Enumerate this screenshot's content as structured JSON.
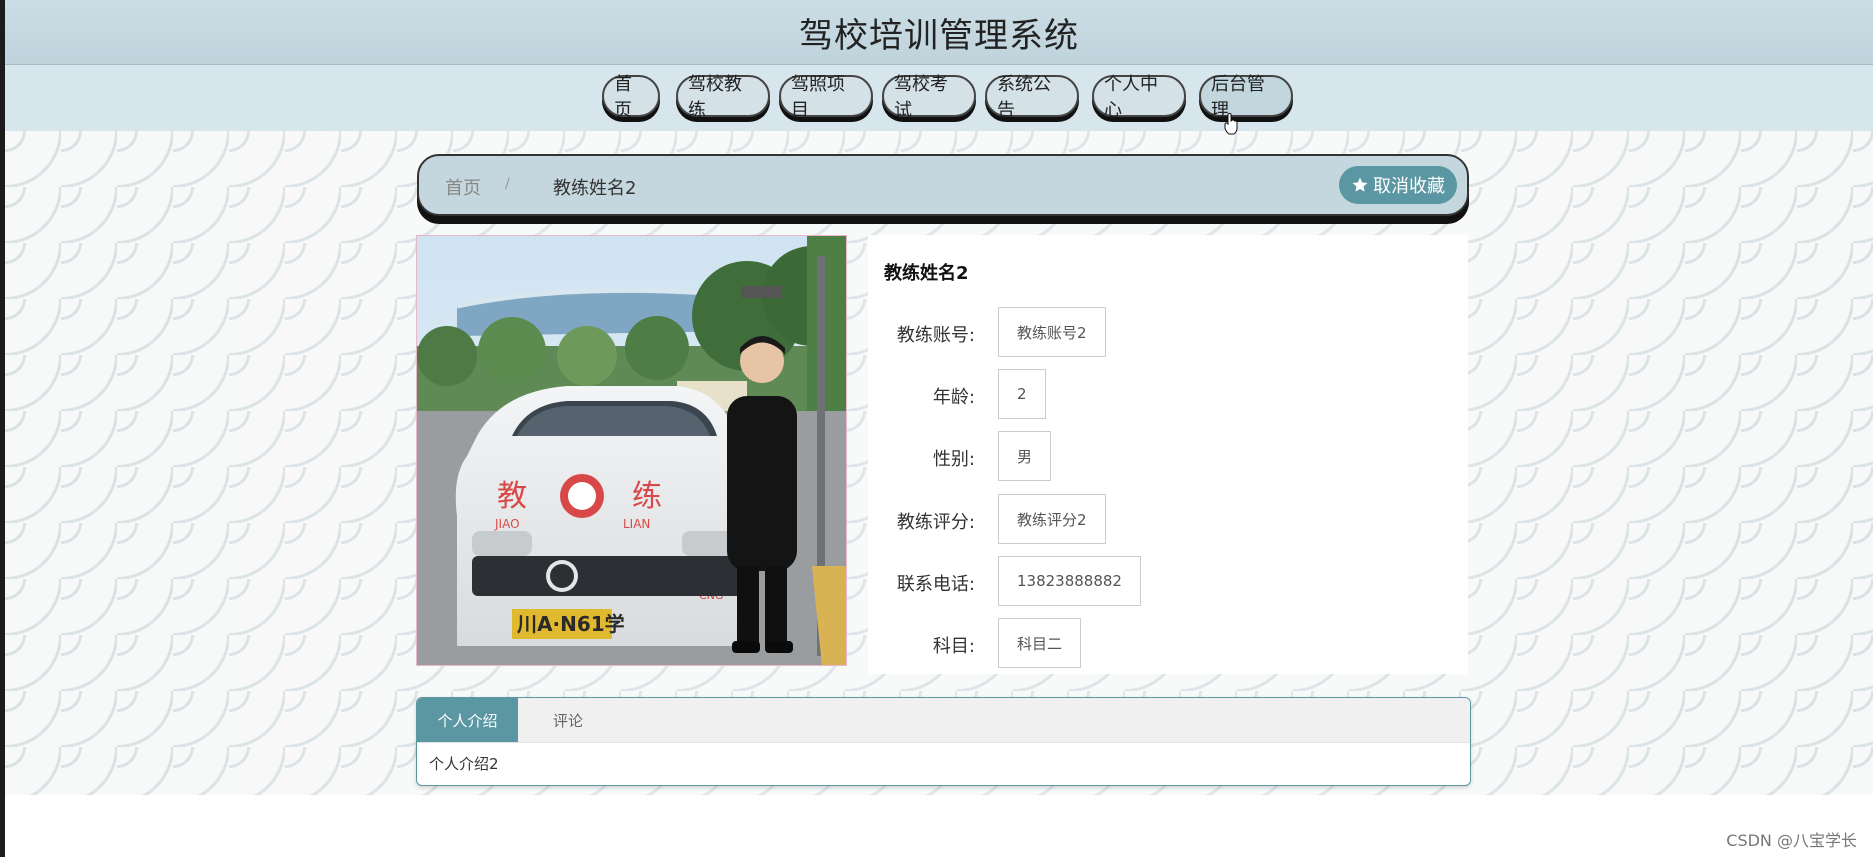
{
  "header": {
    "title": "驾校培训管理系统"
  },
  "nav": {
    "items": [
      {
        "label": "首页"
      },
      {
        "label": "驾校教练"
      },
      {
        "label": "驾照项目"
      },
      {
        "label": "驾校考试"
      },
      {
        "label": "系统公告"
      },
      {
        "label": "个人中心"
      },
      {
        "label": "后台管理"
      }
    ]
  },
  "breadcrumb": {
    "home": "首页",
    "separator": "/",
    "current": "教练姓名2"
  },
  "favorite_button": {
    "icon": "star-icon",
    "label": "取消收藏"
  },
  "photo": {
    "plate": "川A·N61学",
    "logo_text_left": "教",
    "logo_text_right": "练",
    "sub_left": "JIAO",
    "sub_right": "LIAN",
    "badge": "CNG"
  },
  "detail": {
    "name": "教练姓名2",
    "fields": [
      {
        "label": "教练账号:",
        "value": "教练账号2"
      },
      {
        "label": "年龄:",
        "value": "2"
      },
      {
        "label": "性别:",
        "value": "男"
      },
      {
        "label": "教练评分:",
        "value": "教练评分2"
      },
      {
        "label": "联系电话:",
        "value": "13823888882"
      },
      {
        "label": "科目:",
        "value": "科目二"
      }
    ]
  },
  "tabs": {
    "items": [
      {
        "label": "个人介绍"
      },
      {
        "label": "评论"
      }
    ],
    "content": "个人介绍2"
  },
  "watermark": "CSDN @八宝学长",
  "colors": {
    "accent": "#5b96a3",
    "header_bg": "#c5d7de",
    "nav_bg": "#d7e5ec"
  }
}
